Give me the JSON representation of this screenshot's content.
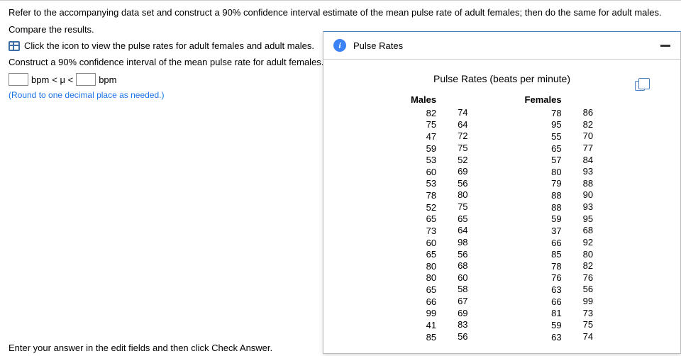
{
  "question": {
    "line1": "Refer to the accompanying data set and construct a 90% confidence interval estimate of the mean pulse rate of adult females; then do the same for adult males.",
    "line2": "Compare the results.",
    "link": "Click the icon to view the pulse rates for adult females and adult males.",
    "construct": "Construct a 90% confidence interval of the mean pulse rate for adult females.",
    "bpm": "bpm",
    "lt_mu_lt": " < μ < ",
    "helper": "(Round to one decimal place as needed.)",
    "footer": "Enter your answer in the edit fields and then click Check Answer."
  },
  "modal": {
    "title": "Pulse Rates",
    "sheet_title": "Pulse Rates (beats per minute)",
    "headers": {
      "males": "Males",
      "females": "Females"
    },
    "males_col1": [
      82,
      75,
      47,
      59,
      53,
      60,
      53,
      78,
      52,
      65,
      73,
      60,
      65,
      80,
      80,
      65,
      66,
      99,
      41,
      85
    ],
    "males_col2": [
      74,
      64,
      72,
      75,
      52,
      69,
      56,
      80,
      75,
      65,
      64,
      98,
      56,
      68,
      60,
      58,
      67,
      69,
      83,
      56
    ],
    "females_col1": [
      78,
      95,
      55,
      65,
      57,
      80,
      79,
      88,
      88,
      59,
      37,
      66,
      85,
      78,
      76,
      63,
      66,
      81,
      59,
      63
    ],
    "females_col2": [
      86,
      82,
      70,
      77,
      84,
      93,
      88,
      90,
      93,
      95,
      68,
      92,
      80,
      82,
      76,
      56,
      99,
      73,
      75,
      74
    ]
  }
}
